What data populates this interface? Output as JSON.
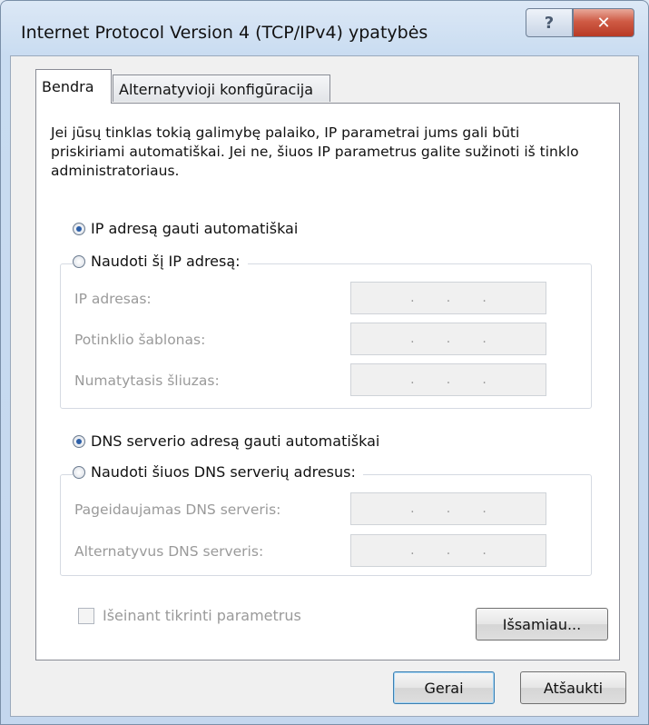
{
  "window": {
    "title": "Internet Protocol Version 4 (TCP/IPv4) ypatybės",
    "help_label": "?",
    "close_label": "✕"
  },
  "tabs": [
    {
      "label": "Bendra",
      "selected": true
    },
    {
      "label": "Alternatyvioji konfigūracija",
      "selected": false
    }
  ],
  "description": "Jei jūsų tinklas tokią galimybę palaiko, IP parametrai jums gali būti priskiriami automatiškai. Jei ne, šiuos IP parametrus galite sužinoti iš tinklo administratoriaus.",
  "ip": {
    "auto_label": "IP adresą gauti automatiškai",
    "auto_selected": true,
    "manual_label": "Naudoti šį IP adresą:",
    "manual_selected": false,
    "fields": [
      {
        "label": "IP adresas:",
        "value": ""
      },
      {
        "label": "Potinklio šablonas:",
        "value": ""
      },
      {
        "label": "Numatytasis šliuzas:",
        "value": ""
      }
    ]
  },
  "dns": {
    "auto_label": "DNS serverio adresą gauti automatiškai",
    "auto_selected": true,
    "manual_label": "Naudoti šiuos DNS serverių adresus:",
    "manual_selected": false,
    "fields": [
      {
        "label": "Pageidaujamas DNS serveris:",
        "value": ""
      },
      {
        "label": "Alternatyvus DNS serveris:",
        "value": ""
      }
    ]
  },
  "validate_label": "Išeinant tikrinti parametrus",
  "validate_checked": false,
  "advanced_label": "Išsamiau...",
  "ok_label": "Gerai",
  "cancel_label": "Atšaukti",
  "ip_dot": "."
}
